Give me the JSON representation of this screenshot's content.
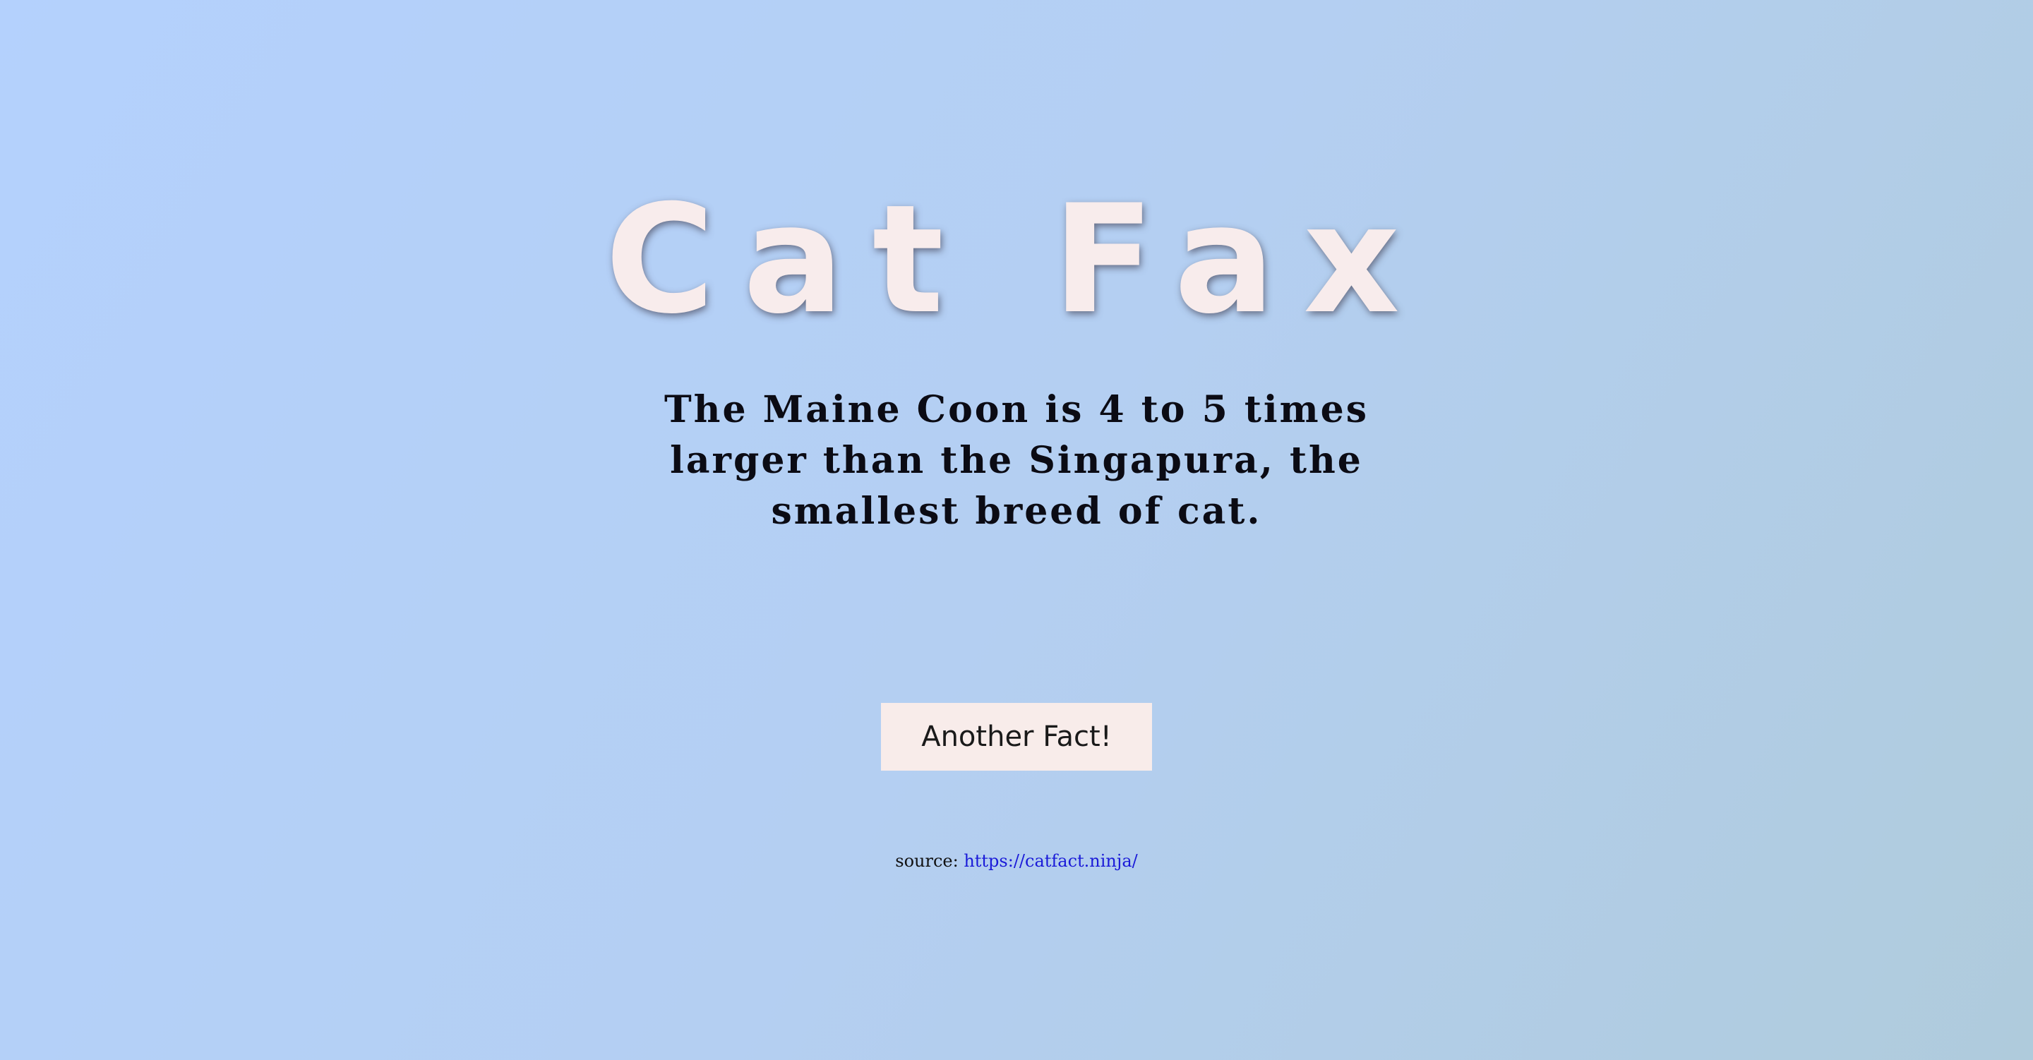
{
  "header": {
    "title": "Cat Fax"
  },
  "main": {
    "fact_text": "The Maine Coon is 4 to 5 times larger than the Singapura, the smallest breed of cat.",
    "another_fact_label": "Another Fact!"
  },
  "footer": {
    "source_label": "source:",
    "source_link_text": "https://catfact.ninja/",
    "source_link_href": "https://catfact.ninja/"
  },
  "colors": {
    "background_start": "#b4d1fd",
    "background_end": "#afcbdc",
    "title": "#f8ecec",
    "button_bg": "#f8ecea",
    "link": "#1a1ad8"
  }
}
